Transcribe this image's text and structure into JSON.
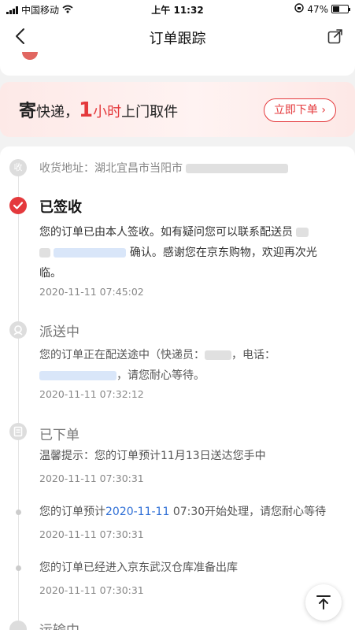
{
  "status_bar": {
    "carrier": "中国移动",
    "time": "上午 11:32",
    "battery": "47%",
    "battery_level": 0.47
  },
  "header": {
    "title": "订单跟踪",
    "back_icon": "chevron-left-icon",
    "share_icon": "share-icon"
  },
  "promo": {
    "prefix": "寄",
    "word": "快递，",
    "number": "1",
    "unit": "小时",
    "suffix": "上门取件",
    "button_label": "立即下单 ›"
  },
  "address": {
    "label": "收货地址：",
    "value": "湖北宜昌市当阳市"
  },
  "events": [
    {
      "title": "已签收",
      "message_1": "您的订单已由本人签收。如有疑问您可以联系配送员",
      "message_2": "确认。感谢您在京东购物，欢迎再次光临。",
      "time": "2020-11-11 07:45:02",
      "icon": "check-icon"
    },
    {
      "title": "派送中",
      "message_1": "您的订单正在配送途中（快递员：",
      "message_2": "，电话：",
      "message_3": "，请您耐心等待。",
      "time": "2020-11-11 07:32:12",
      "icon": "courier-icon"
    },
    {
      "title": "已下单",
      "message": "温馨提示：您的订单预计11月13日送达您手中",
      "time": "2020-11-11 07:30:31",
      "icon": "order-icon"
    },
    {
      "message_prefix": "您的订单预计",
      "message_date": "2020-11-11",
      "message_suffix": " 07:30开始处理，请您耐心等待",
      "time": "2020-11-11 07:30:31"
    },
    {
      "message": "您的订单已经进入京东武汉仓库准备出库",
      "time": "2020-11-11 07:30:31"
    },
    {
      "title": "运输中",
      "icon": "truck-icon"
    }
  ],
  "scroll_top_icon": "arrow-up-to-top-icon",
  "colors": {
    "accent": "#e4393c",
    "link": "#2f6fd6"
  }
}
